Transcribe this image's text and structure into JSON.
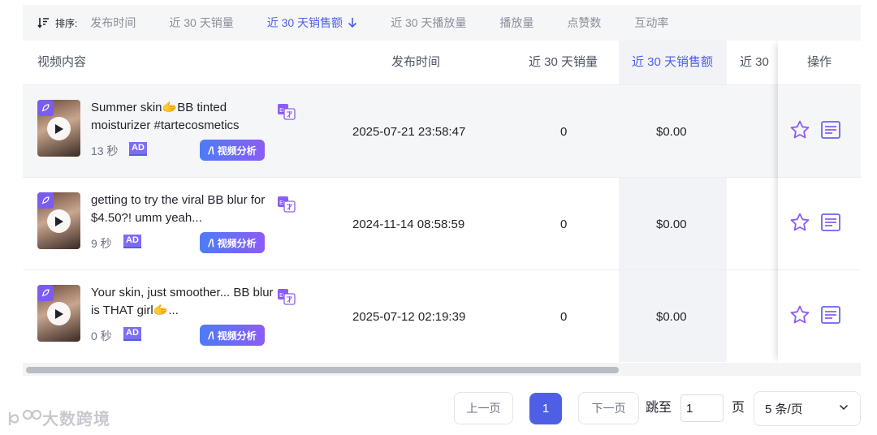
{
  "sort_bar": {
    "label": "排序:",
    "options": [
      "发布时间",
      "近 30 天销量",
      "近 30 天销售额",
      "近 30 天播放量",
      "播放量",
      "点赞数",
      "互动率"
    ],
    "active_index": 2
  },
  "table": {
    "headers": {
      "video": "视频内容",
      "publish_time": "发布时间",
      "sales_30d": "近 30 天销量",
      "revenue_30d": "近 30 天销售额",
      "plays_30d": "近 30",
      "actions": "操作"
    },
    "rows": [
      {
        "title": "Summer skin🫱BB tinted moisturizer #tartecosmetics",
        "duration": "13 秒",
        "ad": "AD",
        "analyze": "视频分析",
        "publish_time": "2025-07-21 23:58:47",
        "sales": "0",
        "revenue": "$0.00"
      },
      {
        "title": "getting to try the viral BB blur for $4.50?! umm yeah...",
        "duration": "9 秒",
        "ad": "AD",
        "analyze": "视频分析",
        "publish_time": "2024-11-14 08:58:59",
        "sales": "0",
        "revenue": "$0.00"
      },
      {
        "title": "Your skin, just smoother... BB blur is THAT girl🫱...",
        "duration": "0 秒",
        "ad": "AD",
        "analyze": "视频分析",
        "publish_time": "2025-07-12 02:19:39",
        "sales": "0",
        "revenue": "$0.00"
      }
    ]
  },
  "pagination": {
    "prev": "上一页",
    "current": "1",
    "next": "下一页",
    "jump_label": "跳至",
    "jump_value": "1",
    "page_unit": "页",
    "page_size": "5 条/页"
  },
  "watermark": "大数跨境",
  "colors": {
    "accent": "#4e5fe6",
    "purple": "#8b5cf6",
    "muted": "#8a8f99"
  }
}
